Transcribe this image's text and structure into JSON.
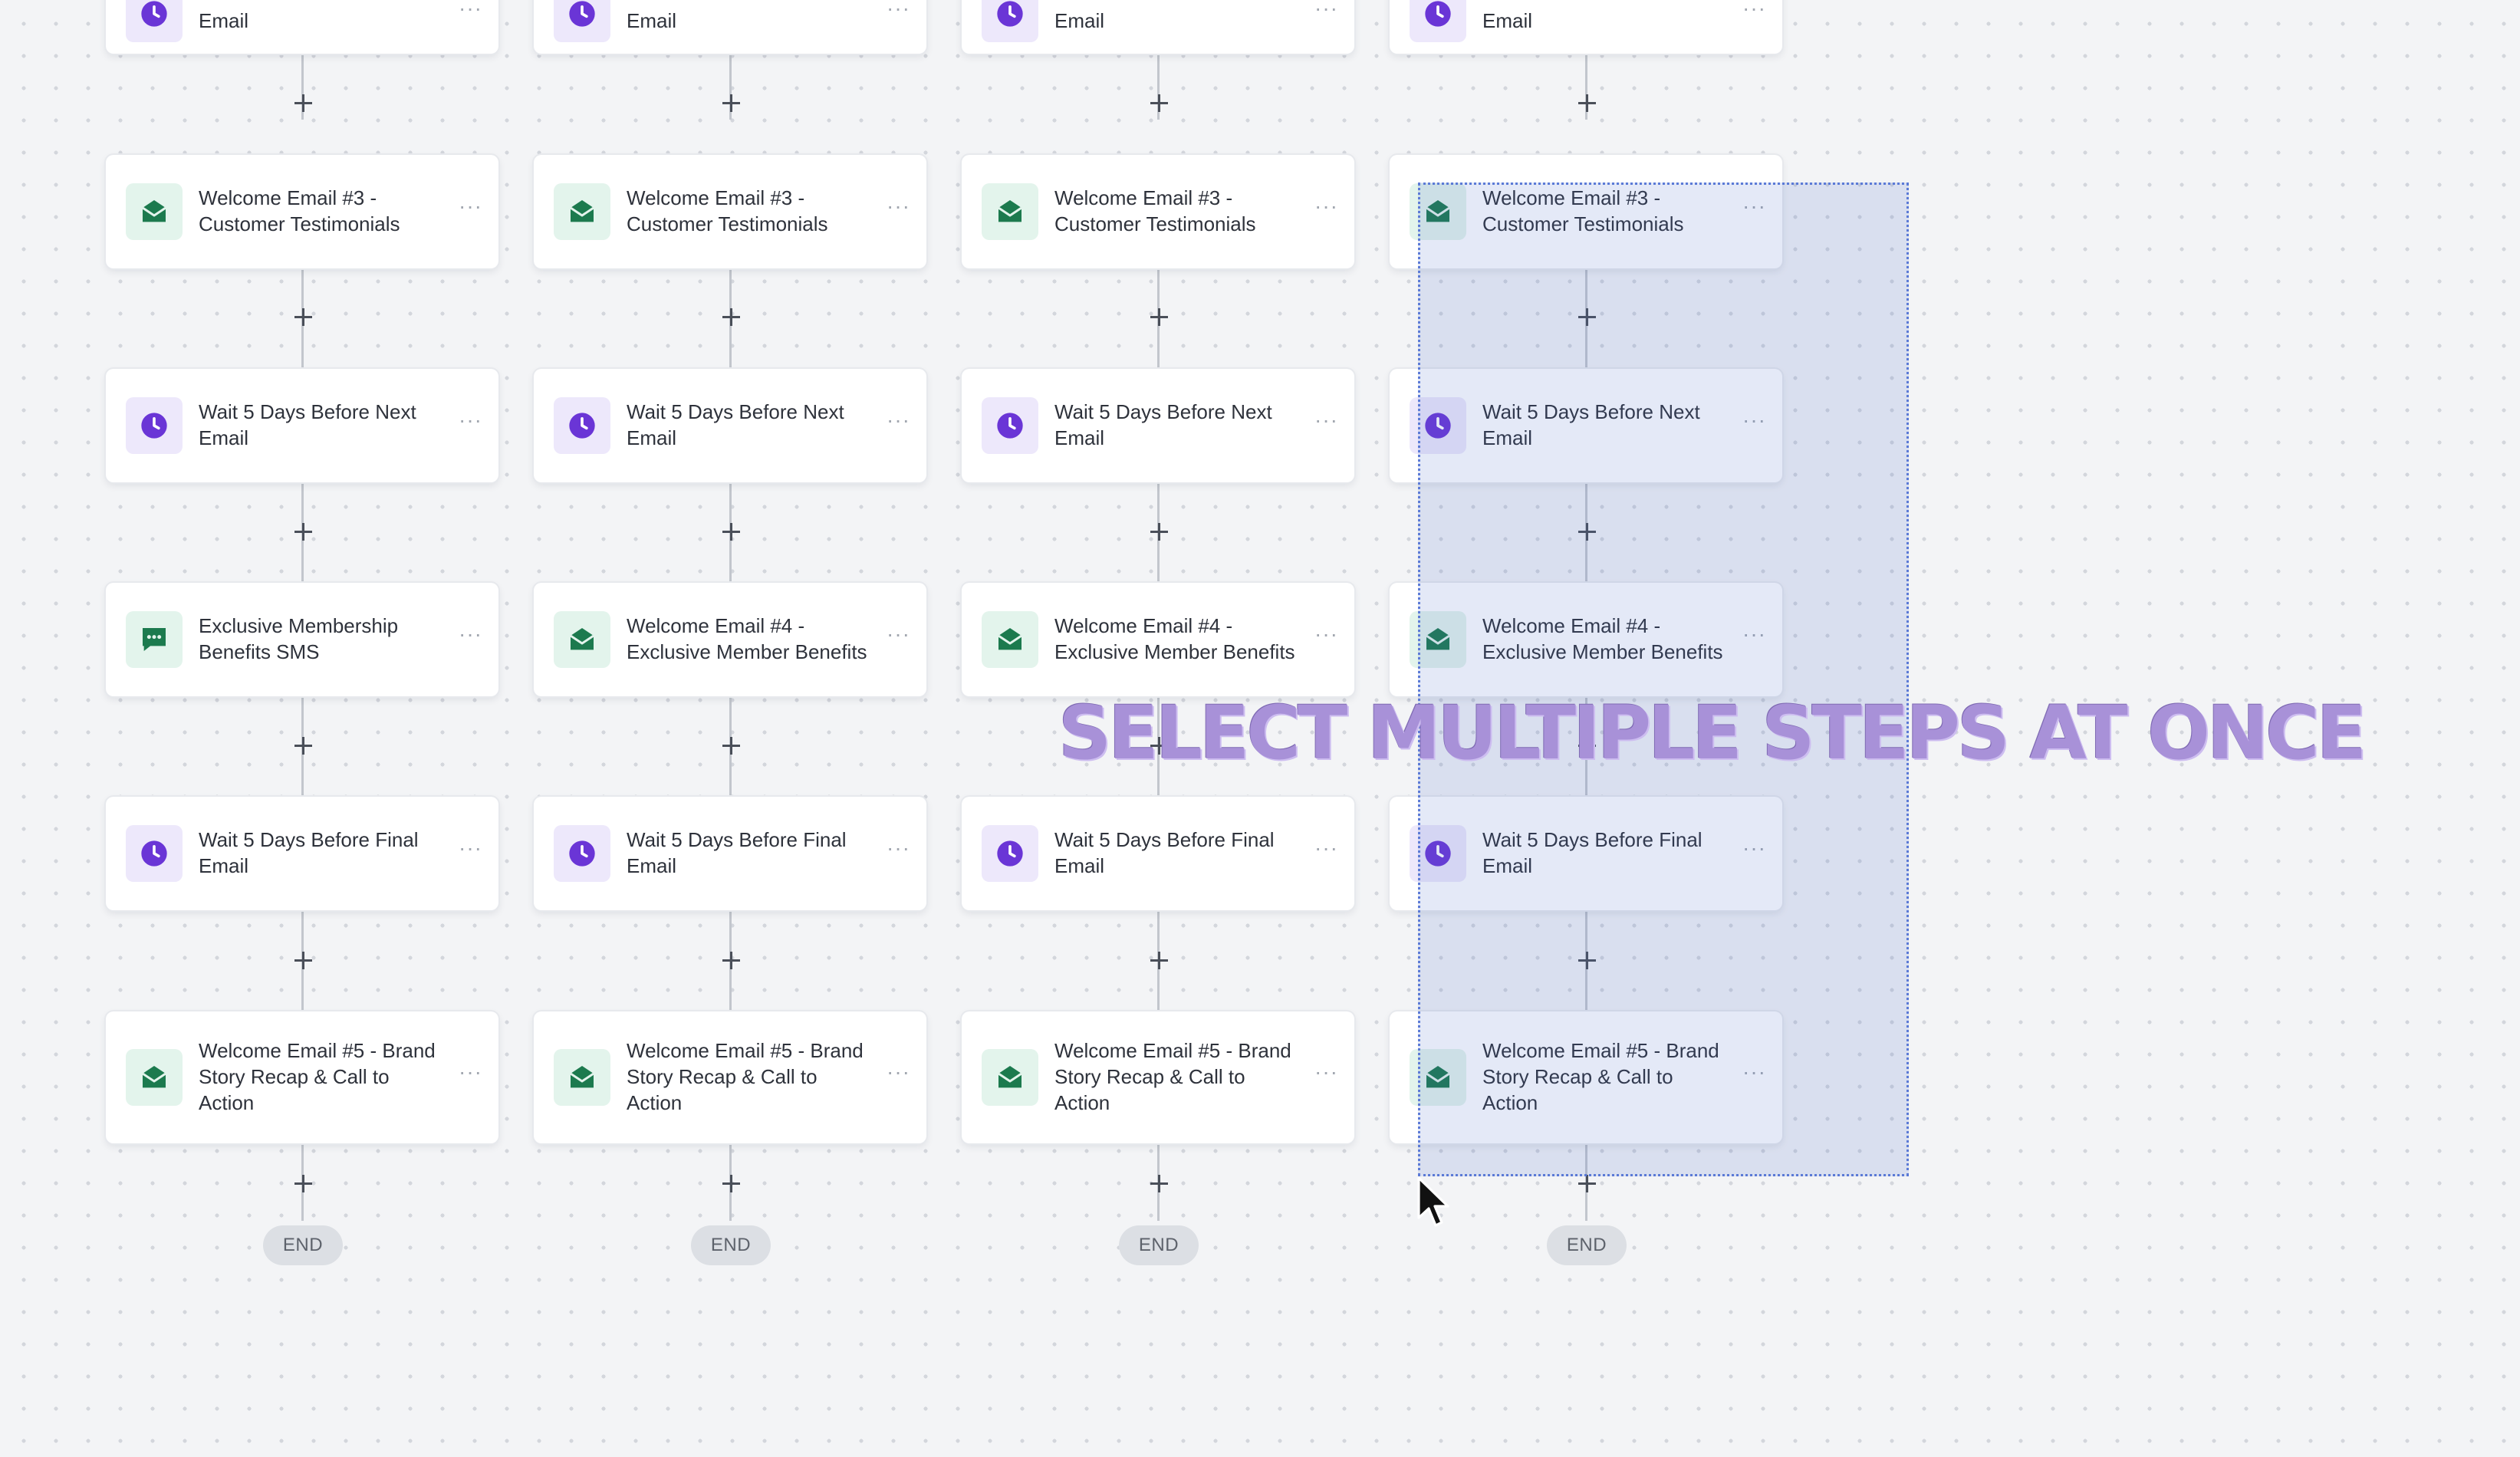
{
  "overlay_caption": "SELECT MULTIPLE STEPS AT ONCE",
  "colors": {
    "canvas_background": "#f3f4f6",
    "email_icon": "#1c7a4e",
    "wait_icon": "#6a35d6",
    "selection_fill": "#486ccc",
    "caption": "#a891d8"
  },
  "end_label": "END",
  "more_menu_glyph": "···",
  "columns": [
    {
      "steps": [
        {
          "type": "wait",
          "icon": "clock-icon",
          "label_line1": "Email",
          "label_line2": "",
          "label_line3": "",
          "selected": false
        },
        {
          "type": "email",
          "icon": "email-icon",
          "label_line1": "Welcome Email #3 -",
          "label_line2": "Customer Testimonials",
          "label_line3": "",
          "selected": false
        },
        {
          "type": "wait",
          "icon": "clock-icon",
          "label_line1": "Wait 5 Days Before Next",
          "label_line2": "Email",
          "label_line3": "",
          "selected": false
        },
        {
          "type": "sms",
          "icon": "sms-icon",
          "label_line1": "Exclusive Membership",
          "label_line2": "Benefits SMS",
          "label_line3": "",
          "selected": false
        },
        {
          "type": "wait",
          "icon": "clock-icon",
          "label_line1": "Wait 5 Days Before Final",
          "label_line2": "Email",
          "label_line3": "",
          "selected": false
        },
        {
          "type": "email",
          "icon": "email-icon",
          "label_line1": "Welcome Email #5 - Brand",
          "label_line2": "Story Recap & Call to",
          "label_line3": "Action",
          "selected": false
        }
      ]
    },
    {
      "steps": [
        {
          "type": "wait",
          "icon": "clock-icon",
          "label_line1": "Email",
          "label_line2": "",
          "label_line3": "",
          "selected": false
        },
        {
          "type": "email",
          "icon": "email-icon",
          "label_line1": "Welcome Email #3 -",
          "label_line2": "Customer Testimonials",
          "label_line3": "",
          "selected": false
        },
        {
          "type": "wait",
          "icon": "clock-icon",
          "label_line1": "Wait 5 Days Before Next",
          "label_line2": "Email",
          "label_line3": "",
          "selected": false
        },
        {
          "type": "email",
          "icon": "email-icon",
          "label_line1": "Welcome Email #4 -",
          "label_line2": "Exclusive Member Benefits",
          "label_line3": "",
          "selected": false
        },
        {
          "type": "wait",
          "icon": "clock-icon",
          "label_line1": "Wait 5 Days Before Final",
          "label_line2": "Email",
          "label_line3": "",
          "selected": false
        },
        {
          "type": "email",
          "icon": "email-icon",
          "label_line1": "Welcome Email #5 - Brand",
          "label_line2": "Story Recap & Call to",
          "label_line3": "Action",
          "selected": false
        }
      ]
    },
    {
      "steps": [
        {
          "type": "wait",
          "icon": "clock-icon",
          "label_line1": "Email",
          "label_line2": "",
          "label_line3": "",
          "selected": false
        },
        {
          "type": "email",
          "icon": "email-icon",
          "label_line1": "Welcome Email #3 -",
          "label_line2": "Customer Testimonials",
          "label_line3": "",
          "selected": false
        },
        {
          "type": "wait",
          "icon": "clock-icon",
          "label_line1": "Wait 5 Days Before Next",
          "label_line2": "Email",
          "label_line3": "",
          "selected": false
        },
        {
          "type": "email",
          "icon": "email-icon",
          "label_line1": "Welcome Email #4 -",
          "label_line2": "Exclusive Member Benefits",
          "label_line3": "",
          "selected": false
        },
        {
          "type": "wait",
          "icon": "clock-icon",
          "label_line1": "Wait 5 Days Before Final",
          "label_line2": "Email",
          "label_line3": "",
          "selected": false
        },
        {
          "type": "email",
          "icon": "email-icon",
          "label_line1": "Welcome Email #5 - Brand",
          "label_line2": "Story Recap & Call to",
          "label_line3": "Action",
          "selected": false
        }
      ]
    },
    {
      "steps": [
        {
          "type": "wait",
          "icon": "clock-icon",
          "label_line1": "Email",
          "label_line2": "",
          "label_line3": "",
          "selected": false
        },
        {
          "type": "email",
          "icon": "email-icon",
          "label_line1": "Welcome Email #3 -",
          "label_line2": "Customer Testimonials",
          "label_line3": "",
          "selected": true
        },
        {
          "type": "wait",
          "icon": "clock-icon",
          "label_line1": "Wait 5 Days Before Next",
          "label_line2": "Email",
          "label_line3": "",
          "selected": true
        },
        {
          "type": "email",
          "icon": "email-icon",
          "label_line1": "Welcome Email #4 -",
          "label_line2": "Exclusive Member Benefits",
          "label_line3": "",
          "selected": true
        },
        {
          "type": "wait",
          "icon": "clock-icon",
          "label_line1": "Wait 5 Days Before Final",
          "label_line2": "Email",
          "label_line3": "",
          "selected": true
        },
        {
          "type": "email",
          "icon": "email-icon",
          "label_line1": "Welcome Email #5 - Brand",
          "label_line2": "Story Recap & Call to",
          "label_line3": "Action",
          "selected": true
        }
      ]
    }
  ]
}
